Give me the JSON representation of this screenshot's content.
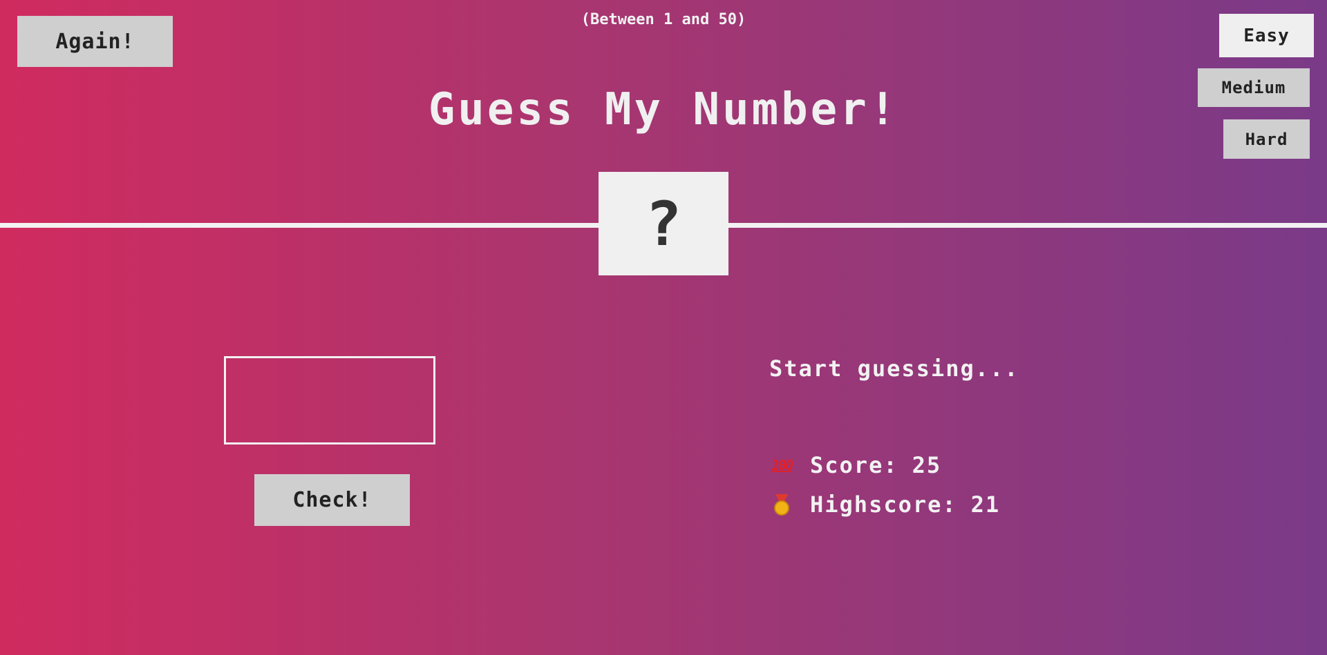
{
  "header": {
    "again_label": "Again!",
    "range_text": "(Between 1 and 50)",
    "title": "Guess My Number!"
  },
  "difficulty": {
    "easy_label": "Easy",
    "medium_label": "Medium",
    "hard_label": "Hard",
    "selected": "Easy"
  },
  "secret_number": {
    "display": "?"
  },
  "guess": {
    "value": "",
    "check_label": "Check!"
  },
  "status": {
    "message": "Start guessing...",
    "score_label": "Score:",
    "score_value": "25",
    "highscore_label": "Highscore:",
    "highscore_value": "21",
    "score_icon": "hundred-points-icon",
    "highscore_icon": "medal-icon"
  },
  "colors": {
    "gradient_start": "#d02b5f",
    "gradient_end": "#7a3a88",
    "button_bg": "#cfcfcf",
    "selected_button_bg": "#efefef",
    "text": "#eeeeee"
  }
}
